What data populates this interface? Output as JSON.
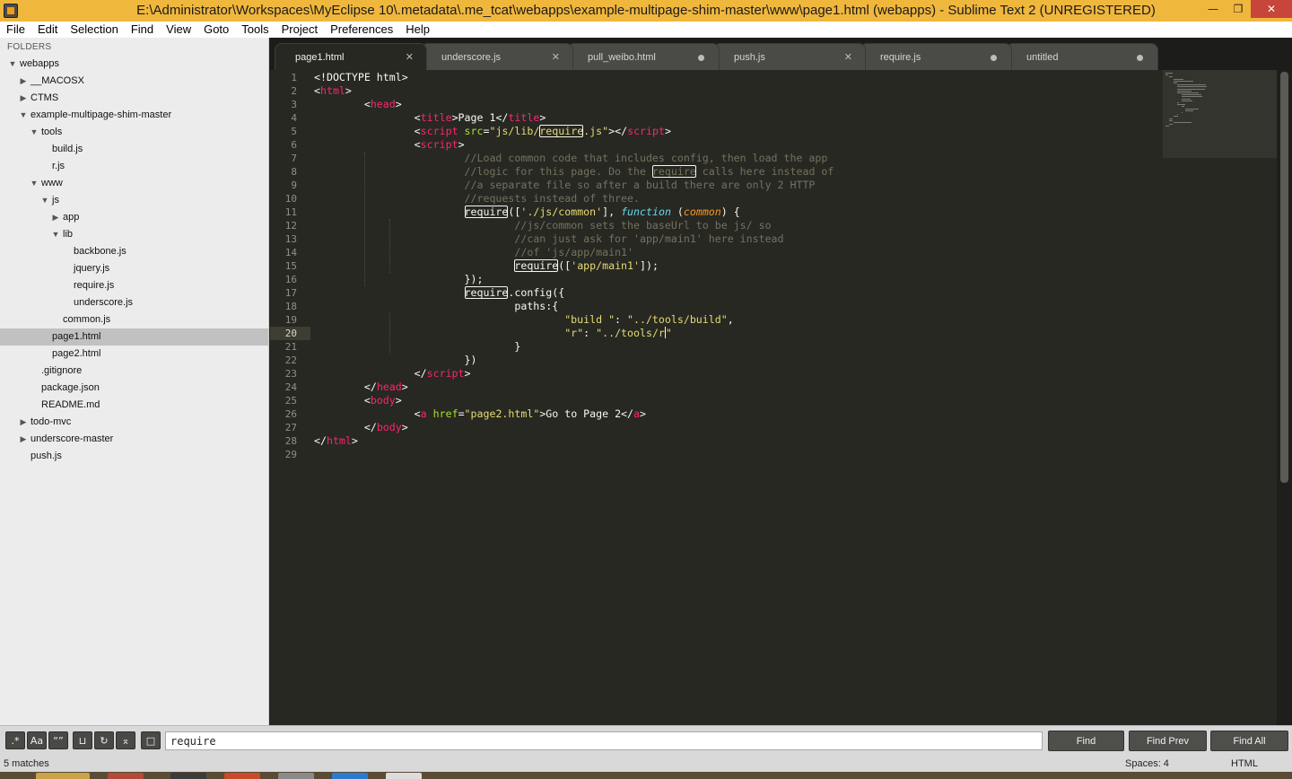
{
  "window": {
    "title": "E:\\Administrator\\Workspaces\\MyEclipse 10\\.metadata\\.me_tcat\\webapps\\example-multipage-shim-master\\www\\page1.html (webapps) - Sublime Text 2 (UNREGISTERED)",
    "minimize_glyph": "—",
    "restore_glyph": "❐",
    "close_glyph": "✕"
  },
  "menu": [
    "File",
    "Edit",
    "Selection",
    "Find",
    "View",
    "Goto",
    "Tools",
    "Project",
    "Preferences",
    "Help"
  ],
  "sidebar": {
    "header": "FOLDERS",
    "tree": [
      {
        "name": "webapps",
        "arrow": "▼"
      },
      {
        "name": "__MACOSX",
        "arrow": "▶"
      },
      {
        "name": "CTMS",
        "arrow": "▶"
      },
      {
        "name": "example-multipage-shim-master",
        "arrow": "▼"
      },
      {
        "name": "tools",
        "arrow": "▼"
      },
      {
        "name": "build.js",
        "arrow": ""
      },
      {
        "name": "r.js",
        "arrow": ""
      },
      {
        "name": "www",
        "arrow": "▼"
      },
      {
        "name": "js",
        "arrow": "▼"
      },
      {
        "name": "app",
        "arrow": "▶"
      },
      {
        "name": "lib",
        "arrow": "▼"
      },
      {
        "name": "backbone.js",
        "arrow": ""
      },
      {
        "name": "jquery.js",
        "arrow": ""
      },
      {
        "name": "require.js",
        "arrow": ""
      },
      {
        "name": "underscore.js",
        "arrow": ""
      },
      {
        "name": "common.js",
        "arrow": ""
      },
      {
        "name": "page1.html",
        "arrow": "",
        "selected": true
      },
      {
        "name": "page2.html",
        "arrow": ""
      },
      {
        "name": ".gitignore",
        "arrow": ""
      },
      {
        "name": "package.json",
        "arrow": ""
      },
      {
        "name": "README.md",
        "arrow": ""
      },
      {
        "name": "todo-mvc",
        "arrow": "▶"
      },
      {
        "name": "underscore-master",
        "arrow": "▶"
      },
      {
        "name": "push.js",
        "arrow": ""
      }
    ]
  },
  "tabs": [
    {
      "label": "page1.html",
      "state": "close",
      "glyph": "✕",
      "active": true
    },
    {
      "label": "underscore.js",
      "state": "close",
      "glyph": "✕"
    },
    {
      "label": "pull_weibo.html",
      "state": "dirty"
    },
    {
      "label": "push.js",
      "state": "close",
      "glyph": "✕"
    },
    {
      "label": "require.js",
      "state": "dirty"
    },
    {
      "label": "untitled",
      "state": "dirty"
    }
  ],
  "editor": {
    "line_numbers": [
      "1",
      "2",
      "3",
      "4",
      "5",
      "6",
      "7",
      "8",
      "9",
      "10",
      "11",
      "12",
      "13",
      "14",
      "15",
      "16",
      "17",
      "18",
      "19",
      "20",
      "21",
      "22",
      "23",
      "24",
      "25",
      "26",
      "27",
      "28",
      "29"
    ],
    "current_line": "20",
    "code_lines": [
      [
        [
          "p",
          "<!DOCTYPE html>"
        ]
      ],
      [
        [
          "p",
          "<"
        ],
        [
          "tag",
          "html"
        ],
        [
          "p",
          ">"
        ]
      ],
      [
        [
          "p",
          "        <"
        ],
        [
          "tag",
          "head"
        ],
        [
          "p",
          ">"
        ]
      ],
      [
        [
          "p",
          "                <"
        ],
        [
          "tag",
          "title"
        ],
        [
          "p",
          ">Page 1</"
        ],
        [
          "tag",
          "title"
        ],
        [
          "p",
          ">"
        ]
      ],
      [
        [
          "p",
          "                <"
        ],
        [
          "tag",
          "script"
        ],
        [
          "p",
          " "
        ],
        [
          "attr",
          "src"
        ],
        [
          "p",
          "="
        ],
        [
          "str",
          "\"js/lib/"
        ],
        [
          "mstr",
          "require"
        ],
        [
          "str",
          ".js\""
        ],
        [
          "p",
          "></"
        ],
        [
          "tag",
          "script"
        ],
        [
          "p",
          ">"
        ]
      ],
      [
        [
          "p",
          "                <"
        ],
        [
          "tag",
          "script"
        ],
        [
          "p",
          ">"
        ]
      ],
      [
        [
          "p",
          "                        "
        ],
        [
          "cm",
          "//Load common code that includes config, then load the app"
        ]
      ],
      [
        [
          "p",
          "                        "
        ],
        [
          "cm",
          "//logic for this page. Do the "
        ],
        [
          "mcm",
          "require"
        ],
        [
          "cm",
          " calls here instead of"
        ]
      ],
      [
        [
          "p",
          "                        "
        ],
        [
          "cm",
          "//a separate file so after a build there are only 2 HTTP"
        ]
      ],
      [
        [
          "p",
          "                        "
        ],
        [
          "cm",
          "//requests instead of three."
        ]
      ],
      [
        [
          "p",
          "                        "
        ],
        [
          "m",
          "require"
        ],
        [
          "p",
          "(["
        ],
        [
          "str",
          "'./js/common'"
        ],
        [
          "p",
          "], "
        ],
        [
          "kw",
          "function"
        ],
        [
          "p",
          " ("
        ],
        [
          "param",
          "common"
        ],
        [
          "p",
          ") {"
        ]
      ],
      [
        [
          "p",
          "                                "
        ],
        [
          "cm",
          "//js/common sets the baseUrl to be js/ so"
        ]
      ],
      [
        [
          "p",
          "                                "
        ],
        [
          "cm",
          "//can just ask for 'app/main1' here instead"
        ]
      ],
      [
        [
          "p",
          "                                "
        ],
        [
          "cm",
          "//of 'js/app/main1'"
        ]
      ],
      [
        [
          "p",
          "                                "
        ],
        [
          "m",
          "require"
        ],
        [
          "p",
          "(["
        ],
        [
          "str",
          "'app/main1'"
        ],
        [
          "p",
          "]);"
        ]
      ],
      [
        [
          "p",
          "                        });"
        ]
      ],
      [
        [
          "p",
          "                        "
        ],
        [
          "m",
          "require"
        ],
        [
          "p",
          ".config({"
        ]
      ],
      [
        [
          "p",
          "                                paths:{"
        ]
      ],
      [
        [
          "p",
          "                                        "
        ],
        [
          "str",
          "\"build \""
        ],
        [
          "p",
          ": "
        ],
        [
          "str",
          "\"../tools/build\""
        ],
        [
          "p",
          ","
        ]
      ],
      [
        [
          "p",
          "                                        "
        ],
        [
          "str",
          "\"r\""
        ],
        [
          "p",
          ": "
        ],
        [
          "str",
          "\"../tools/r"
        ],
        [
          "caret",
          ""
        ],
        [
          "str",
          "\""
        ]
      ],
      [
        [
          "p",
          "                                }"
        ]
      ],
      [
        [
          "p",
          "                        })"
        ]
      ],
      [
        [
          "p",
          "                </"
        ],
        [
          "tag",
          "script"
        ],
        [
          "p",
          ">"
        ]
      ],
      [
        [
          "p",
          "        </"
        ],
        [
          "tag",
          "head"
        ],
        [
          "p",
          ">"
        ]
      ],
      [
        [
          "p",
          "        <"
        ],
        [
          "tag",
          "body"
        ],
        [
          "p",
          ">"
        ]
      ],
      [
        [
          "p",
          "                <"
        ],
        [
          "tag",
          "a"
        ],
        [
          "p",
          " "
        ],
        [
          "attr",
          "href"
        ],
        [
          "p",
          "="
        ],
        [
          "str",
          "\"page2.html\""
        ],
        [
          "p",
          ">Go to Page 2</"
        ],
        [
          "tag",
          "a"
        ],
        [
          "p",
          ">"
        ]
      ],
      [
        [
          "p",
          "        </"
        ],
        [
          "tag",
          "body"
        ],
        [
          "p",
          ">"
        ]
      ],
      [
        [
          "p",
          "</"
        ],
        [
          "tag",
          "html"
        ],
        [
          "p",
          ">"
        ]
      ],
      []
    ]
  },
  "find_panel": {
    "toggles": [
      {
        "glyph": ".*",
        "name": "regex-toggle"
      },
      {
        "glyph": "Aa",
        "name": "case-sensitive-toggle"
      },
      {
        "glyph": "“”",
        "name": "whole-word-toggle"
      },
      {
        "glyph": "⊔",
        "name": "reverse-direction-toggle"
      },
      {
        "glyph": "↻",
        "name": "wrap-toggle"
      },
      {
        "glyph": "⌅",
        "name": "in-selection-toggle"
      },
      {
        "glyph": "□",
        "name": "highlight-matches-toggle"
      }
    ],
    "query": "require",
    "buttons": {
      "find": "Find",
      "find_prev": "Find Prev",
      "find_all": "Find All"
    }
  },
  "status": {
    "matches": "5 matches",
    "spaces": "Spaces: 4",
    "syntax": "HTML"
  },
  "colors": {
    "titlebar_bg": "#f0b73d",
    "editor_bg": "#272822",
    "tag": "#f92672",
    "attr": "#a6e22e",
    "string": "#e6db74",
    "comment": "#75715e",
    "keyword": "#66d9ef"
  }
}
